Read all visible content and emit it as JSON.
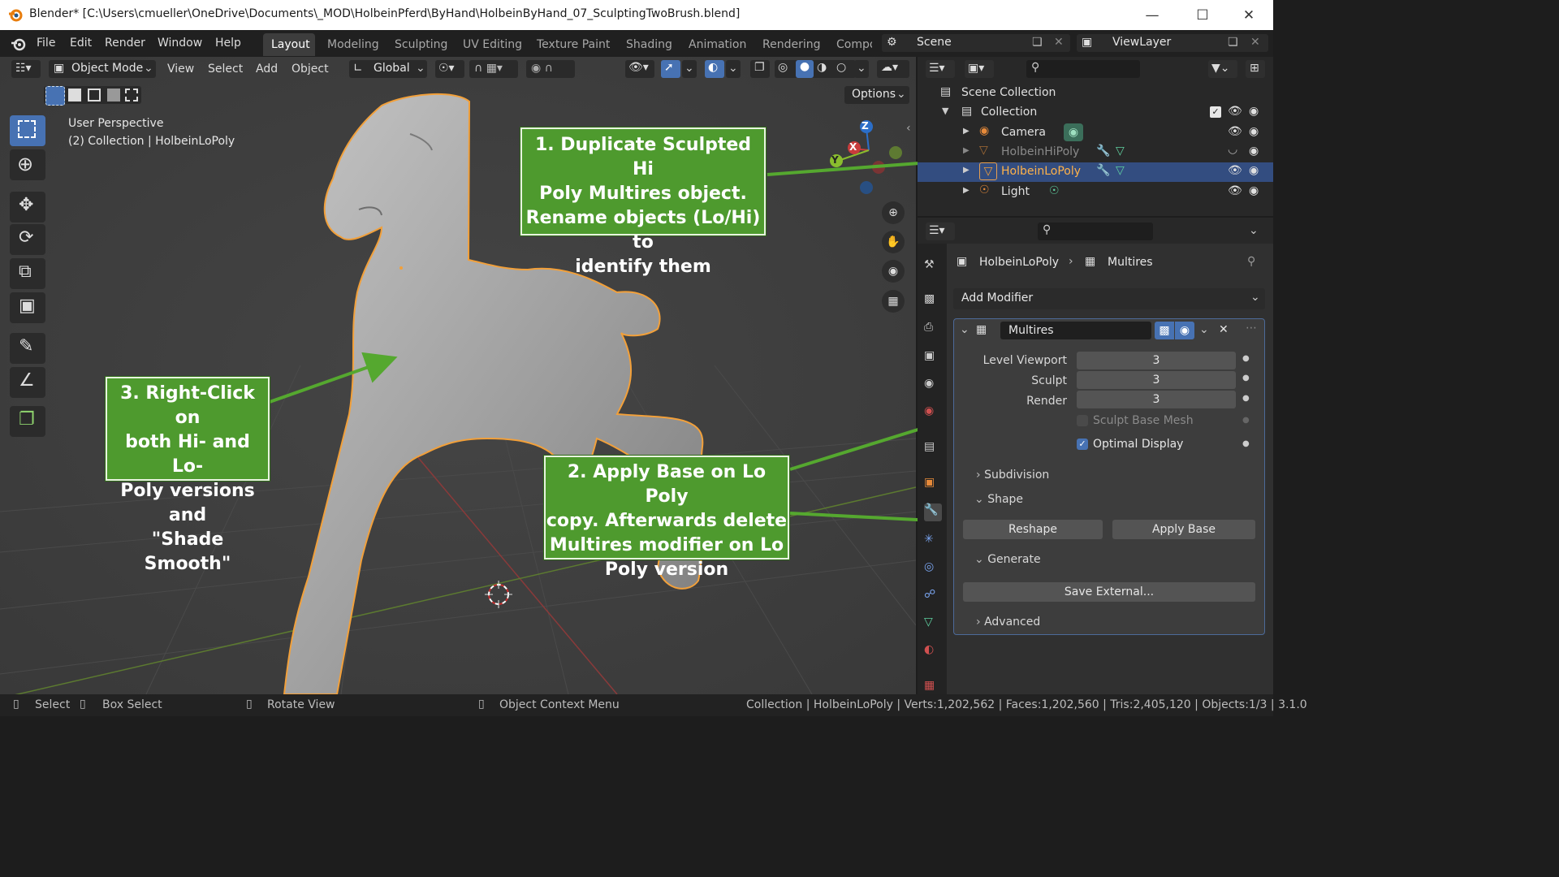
{
  "window": {
    "title": "Blender* [C:\\Users\\cmueller\\OneDrive\\Documents\\_MOD\\HolbeinPferd\\ByHand\\HolbeinByHand_07_SculptingTwoBrush.blend]",
    "minimize": "—",
    "maximize": "☐",
    "close": "✕"
  },
  "menu": [
    "File",
    "Edit",
    "Render",
    "Window",
    "Help"
  ],
  "workspaces": [
    "Layout",
    "Modeling",
    "Sculpting",
    "UV Editing",
    "Texture Paint",
    "Shading",
    "Animation",
    "Rendering",
    "Compo"
  ],
  "scene_name": "Scene",
  "view_layer": "ViewLayer",
  "viewport": {
    "mode": "Object Mode",
    "menus": [
      "View",
      "Select",
      "Add",
      "Object"
    ],
    "orientation": "Global",
    "options_label": "Options",
    "overlay_title": "User Perspective",
    "overlay_sub": "(2) Collection | HolbeinLoPoly",
    "gizmo": {
      "z": "Z",
      "y": "Y",
      "x": "X"
    }
  },
  "annotations": {
    "note1": [
      "1. Duplicate Sculpted Hi",
      "Poly Multires object.",
      "Rename objects (Lo/Hi) to",
      "identify them"
    ],
    "note2": [
      "2. Apply Base on Lo Poly",
      "copy. Afterwards delete",
      "Multires modifier on Lo",
      "Poly version"
    ],
    "note3": [
      "3. Right-Click on",
      "both Hi- and Lo-",
      "Poly versions and",
      "\"Shade Smooth\""
    ]
  },
  "outliner": {
    "scene_collection": "Scene Collection",
    "collection": "Collection",
    "items": [
      {
        "label": "Camera",
        "selected": false,
        "dim": false
      },
      {
        "label": "HolbeinHiPoly",
        "selected": false,
        "dim": true
      },
      {
        "label": "HolbeinLoPoly",
        "selected": true,
        "dim": false
      },
      {
        "label": "Light",
        "selected": false,
        "dim": false
      }
    ]
  },
  "properties": {
    "object_name": "HolbeinLoPoly",
    "modifier_context": "Multires",
    "add_modifier": "Add Modifier",
    "modifier_name": "Multires",
    "levels": [
      {
        "label": "Level Viewport",
        "value": "3"
      },
      {
        "label": "Sculpt",
        "value": "3"
      },
      {
        "label": "Render",
        "value": "3"
      }
    ],
    "sculpt_base_mesh": "Sculpt Base Mesh",
    "optimal_display": "Optimal Display",
    "optimal_display_checked": true,
    "subdivision": "Subdivision",
    "shape": "Shape",
    "reshape": "Reshape",
    "apply_base": "Apply Base",
    "generate": "Generate",
    "save_external": "Save External...",
    "advanced": "Advanced"
  },
  "statusbar": {
    "select": "Select",
    "box_select": "Box Select",
    "rotate_view": "Rotate View",
    "context_menu": "Object Context Menu",
    "stats": "Collection | HolbeinLoPoly | Verts:1,202,562 | Faces:1,202,560 | Tris:2,405,120 | Objects:1/3 | 3.1.0"
  },
  "colors": {
    "accent": "#4772b3",
    "note_green": "#4e9a2e",
    "selection_orange": "#f2a03a"
  }
}
